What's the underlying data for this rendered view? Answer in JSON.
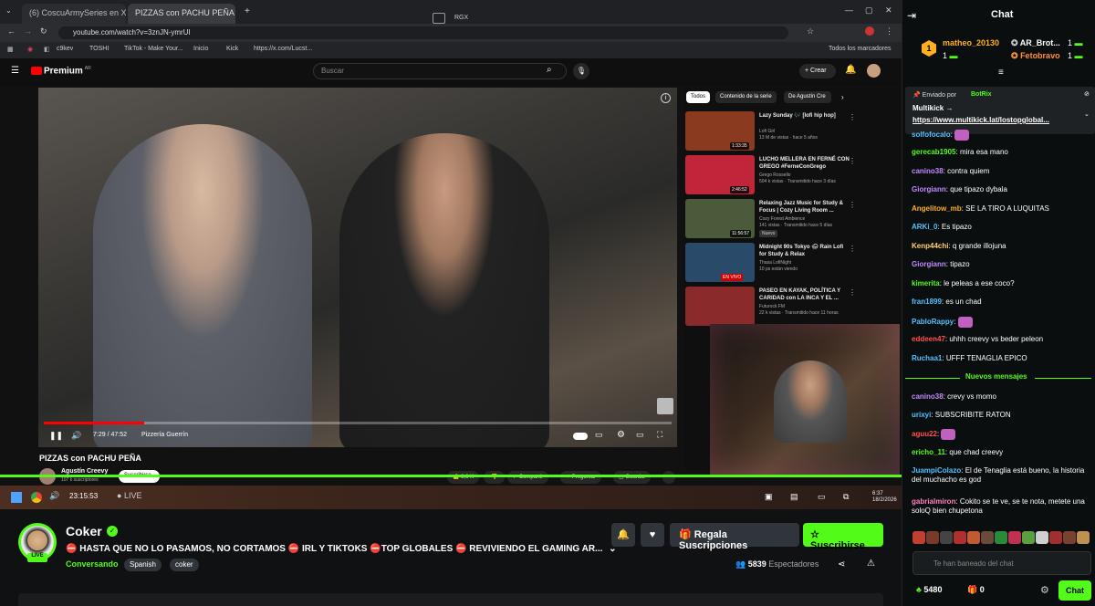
{
  "browser": {
    "tab1_title": "(6) CoscuArmySeries en X: \"ZEN…",
    "tab2_title": "PIZZAS con PACHU PEÑA",
    "url": "youtube.com/watch?v=3znJN-ymrUI",
    "overlay_label": "RGX",
    "bookmarks": [
      "c9kev",
      "TOSHI",
      "TikTok - Make Your...",
      "Inicio",
      "Kick",
      "https://x.com/Lucst...",
      "Todos los marcadores"
    ]
  },
  "youtube": {
    "logo": "Premium",
    "logo_region": "AR",
    "search_placeholder": "Buscar",
    "create_label": "+ Crear",
    "video_time": "7:29 / 47:52",
    "chapter": "Pizzería Guerrín",
    "video_title": "PIZZAS con PACHU PEÑA",
    "channel": "Agustín Creevy",
    "channel_subs": "107 k suscriptores",
    "subscribe": "Suscribirse",
    "likes": "8,6 K",
    "share": "Compartir",
    "ask": "Preguntar",
    "save": "Guardar",
    "chips": [
      "Todos",
      "Contenido de la serie",
      "De Agustín Cre"
    ],
    "sidebar": [
      {
        "title": "Lazy Sunday 🎶 [lofi hip hop]",
        "channel": "Lofi Girl",
        "meta": "13 M de vistas · hace 5 años",
        "dur": "1:33:35",
        "color": "#8a3a1e"
      },
      {
        "title": "LUCHO MELLERA EN FERNÉ CON GREGO #FerneConGrego",
        "channel": "Grego Rossello",
        "meta": "504 k vistas · Transmitido hace 3 días",
        "dur": "2:46:52",
        "color": "#c0253a"
      },
      {
        "title": "Relaxing Jazz Music for Study & Focus | Cozy Living Room ...",
        "channel": "Cozy Forest Ambience",
        "meta": "141 vistas · Transmitido hace 5 días",
        "dur": "11:56:57",
        "badge": "Nuevo",
        "color": "#4a5a3a"
      },
      {
        "title": "Midnight 90s Tokyo 🌧 Rain Lofi for Study & Relax",
        "channel": "Thasa LofiNight",
        "meta": "10 ps están viendo",
        "dur": "EN VIVO",
        "color": "#2a4a6a"
      },
      {
        "title": "PASEO EN KAYAK, POLÍTICA Y CARIDAD con LA INCA Y EL ...",
        "channel": "Futurock FM",
        "meta": "22 k vistas · Transmitido hace 11 horas",
        "dur": "",
        "color": "#8a2a2a"
      }
    ]
  },
  "taskbar": {
    "clock": "23:15:53",
    "live": "LIVE",
    "time": "6:37",
    "date": "18/2/2026"
  },
  "channel": {
    "name": "Coker",
    "live_badge": "LIVE",
    "title": "⛔ HASTA QUE NO LO PASAMOS, NO CORTAMOS ⛔ IRL Y TIKTOKS ⛔TOP GLOBALES ⛔ REVIVIENDO EL GAMING AR...",
    "category": "Conversando",
    "tags": [
      "Spanish",
      "coker"
    ],
    "gift_label": "Regala Suscripciones",
    "subscribe_label": "Suscribirse",
    "viewers": "5839",
    "viewers_label": "Espectadores"
  },
  "chat": {
    "title": "Chat",
    "leaders": [
      {
        "rank": "1",
        "user": "matheo_20130",
        "count": "1",
        "color": "#ffb020"
      },
      {
        "rank": "",
        "user": "AR_Brot...",
        "count": "1",
        "color": "#ffffff"
      },
      {
        "rank": "",
        "user": "Fetobravo",
        "count": "1",
        "color": "#ff9040"
      }
    ],
    "pinned": {
      "label": "Enviado por",
      "by": "BotRix",
      "title": "Multikick →",
      "url": "https://www.multikick.lat/lostopglobal..."
    },
    "messages_old": [
      {
        "user": "solfofocalo",
        "text": "",
        "color": "#53c2ff"
      },
      {
        "user": "gerecab1905",
        "text": "mira esa mano",
        "color": "#53fc18"
      },
      {
        "user": "canino38",
        "text": "contra quiem",
        "color": "#c38aff"
      },
      {
        "user": "Giorgiann",
        "text": "que tipazo dybala",
        "color": "#c38aff"
      },
      {
        "user": "Angelitow_mb",
        "text": "SE LA TIRO A LUQUITAS",
        "color": "#ffb020"
      },
      {
        "user": "ARKi_0",
        "text": "Es tipazo",
        "color": "#53c2ff"
      },
      {
        "user": "Kenp44chi",
        "text": "q grande illojuna",
        "color": "#ffd070"
      },
      {
        "user": "Giorgiann",
        "text": "tipazo",
        "color": "#c38aff"
      },
      {
        "user": "kimerita",
        "text": "le peleas a ese coco?",
        "color": "#53fc18"
      },
      {
        "user": "fran1899",
        "text": "es un chad",
        "color": "#53c2ff"
      },
      {
        "user": "PabloRappy",
        "text": "",
        "color": "#53c2ff"
      },
      {
        "user": "eddeen47",
        "text": "uhhh creevy vs beder peleon",
        "color": "#ff5050"
      },
      {
        "user": "Ruchaa1",
        "text": "UFFF TENAGLIA EPICO",
        "color": "#53c2ff"
      }
    ],
    "new_messages_label": "Nuevos mensajes",
    "messages_new": [
      {
        "user": "canino38",
        "text": "crevy vs momo",
        "color": "#c38aff"
      },
      {
        "user": "urixyi",
        "text": "SUBSCRIBITE RATON",
        "color": "#53c2ff"
      },
      {
        "user": "aguu22",
        "text": "",
        "color": "#ff5050"
      },
      {
        "user": "ericho_11",
        "text": "que chad creevy",
        "color": "#53fc18"
      },
      {
        "user": "JuampiColazo",
        "text": "El de Tenaglia está bueno, la historia del muchacho es god",
        "color": "#53c2ff"
      },
      {
        "user": "gabrialmiron",
        "text": "Cokito se te ve, se te nota, metete una soloQ bien chupetona",
        "color": "#ff80c0"
      }
    ],
    "input_placeholder": "Te han baneado del chat",
    "points": "5480",
    "gifts": "0",
    "send_label": "Chat"
  }
}
